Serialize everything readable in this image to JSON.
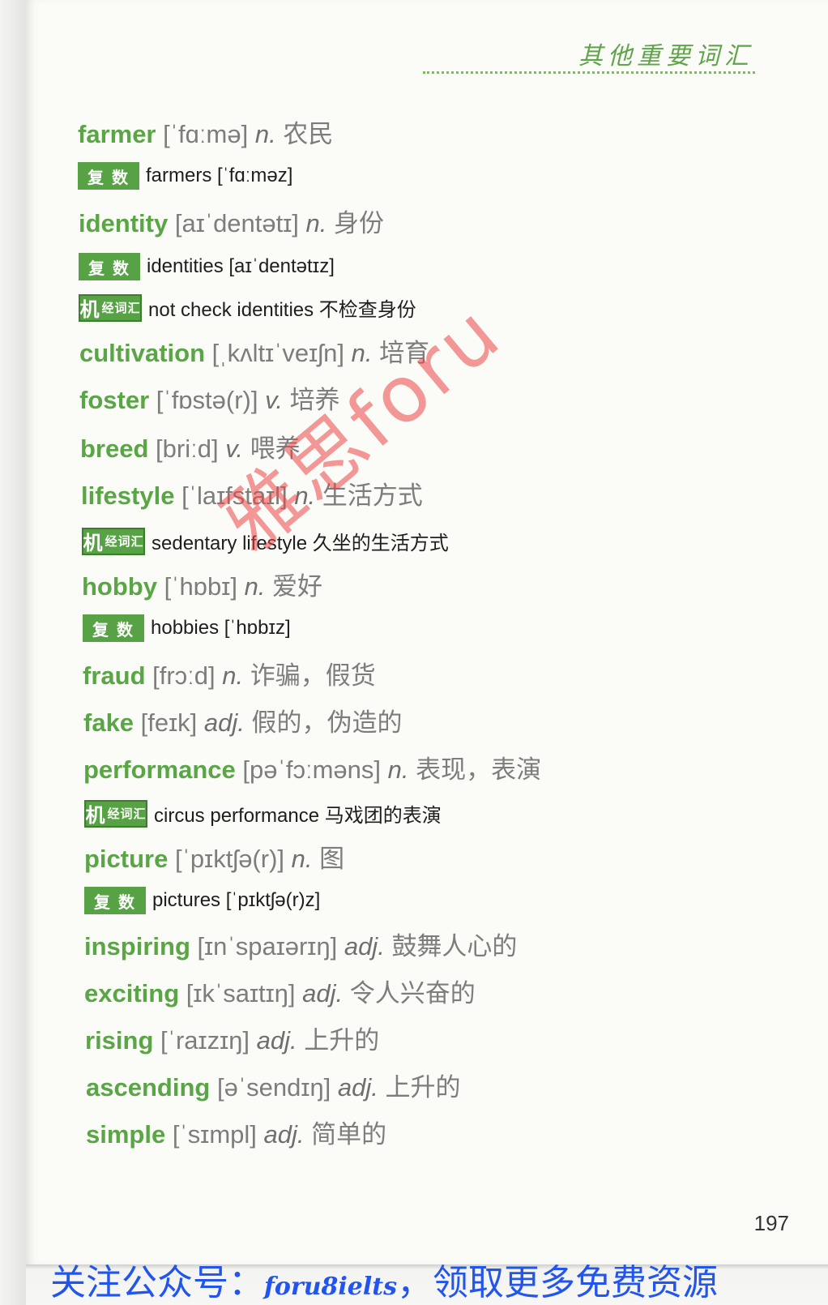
{
  "header": {
    "title": "其他重要词汇"
  },
  "entries": [
    {
      "kind": "main",
      "word": "farmer",
      "phon": "[ˈfɑːmə]",
      "pos": "n.",
      "cn": "农民"
    },
    {
      "kind": "plural",
      "badge": "复数",
      "text": "farmers [ˈfɑːməz]"
    },
    {
      "kind": "main",
      "word": "identity",
      "phon": "[aɪˈdentətɪ]",
      "pos": "n.",
      "cn": "身份"
    },
    {
      "kind": "plural",
      "badge": "复数",
      "text": "identities [aɪˈdentətɪz]"
    },
    {
      "kind": "collocation",
      "badge_big": "机",
      "badge_small": "经词汇",
      "text": "not check identities 不检查身份"
    },
    {
      "kind": "main",
      "word": "cultivation",
      "phon": "[ˌkʌltɪˈveɪʃn]",
      "pos": "n.",
      "cn": "培育"
    },
    {
      "kind": "main",
      "word": "foster",
      "phon": "[ˈfɒstə(r)]",
      "pos": "v.",
      "cn": "培养"
    },
    {
      "kind": "main",
      "word": "breed",
      "phon": "[briːd]",
      "pos": "v.",
      "cn": "喂养"
    },
    {
      "kind": "main",
      "word": "lifestyle",
      "phon": "[ˈlaɪfstaɪl]",
      "pos": "n.",
      "cn": "生活方式"
    },
    {
      "kind": "collocation",
      "badge_big": "机",
      "badge_small": "经词汇",
      "text": "sedentary lifestyle 久坐的生活方式"
    },
    {
      "kind": "main",
      "word": "hobby",
      "phon": "[ˈhɒbɪ]",
      "pos": "n.",
      "cn": "爱好"
    },
    {
      "kind": "plural",
      "badge": "复数",
      "text": "hobbies [ˈhɒbɪz]"
    },
    {
      "kind": "main",
      "word": "fraud",
      "phon": "[frɔːd]",
      "pos": "n.",
      "cn": "诈骗，假货"
    },
    {
      "kind": "main",
      "word": "fake",
      "phon": "[feɪk]",
      "pos": "adj.",
      "cn": "假的，伪造的"
    },
    {
      "kind": "main",
      "word": "performance",
      "phon": "[pəˈfɔːməns]",
      "pos": "n.",
      "cn": "表现，表演"
    },
    {
      "kind": "collocation",
      "badge_big": "机",
      "badge_small": "经词汇",
      "text": "circus performance 马戏团的表演"
    },
    {
      "kind": "main",
      "word": "picture",
      "phon": "[ˈpɪktʃə(r)]",
      "pos": "n.",
      "cn": "图"
    },
    {
      "kind": "plural",
      "badge": "复数",
      "text": "pictures [ˈpɪktʃə(r)z]"
    },
    {
      "kind": "main",
      "word": "inspiring",
      "phon": "[ɪnˈspaɪərɪŋ]",
      "pos": "adj.",
      "cn": "鼓舞人心的"
    },
    {
      "kind": "main",
      "word": "exciting",
      "phon": "[ɪkˈsaɪtɪŋ]",
      "pos": "adj.",
      "cn": "令人兴奋的"
    },
    {
      "kind": "main",
      "word": "rising",
      "phon": "[ˈraɪzɪŋ]",
      "pos": "adj.",
      "cn": "上升的"
    },
    {
      "kind": "main",
      "word": "ascending",
      "phon": "[əˈsendɪŋ]",
      "pos": "adj.",
      "cn": "上升的"
    },
    {
      "kind": "main",
      "word": "simple",
      "phon": "[ˈsɪmpl]",
      "pos": "adj.",
      "cn": "简单的"
    }
  ],
  "watermark": "雅思foru",
  "page_number": "197",
  "footer": {
    "prefix": "关注公众号：",
    "handle": "foru8ielts",
    "suffix": "，领取更多免费资源"
  }
}
